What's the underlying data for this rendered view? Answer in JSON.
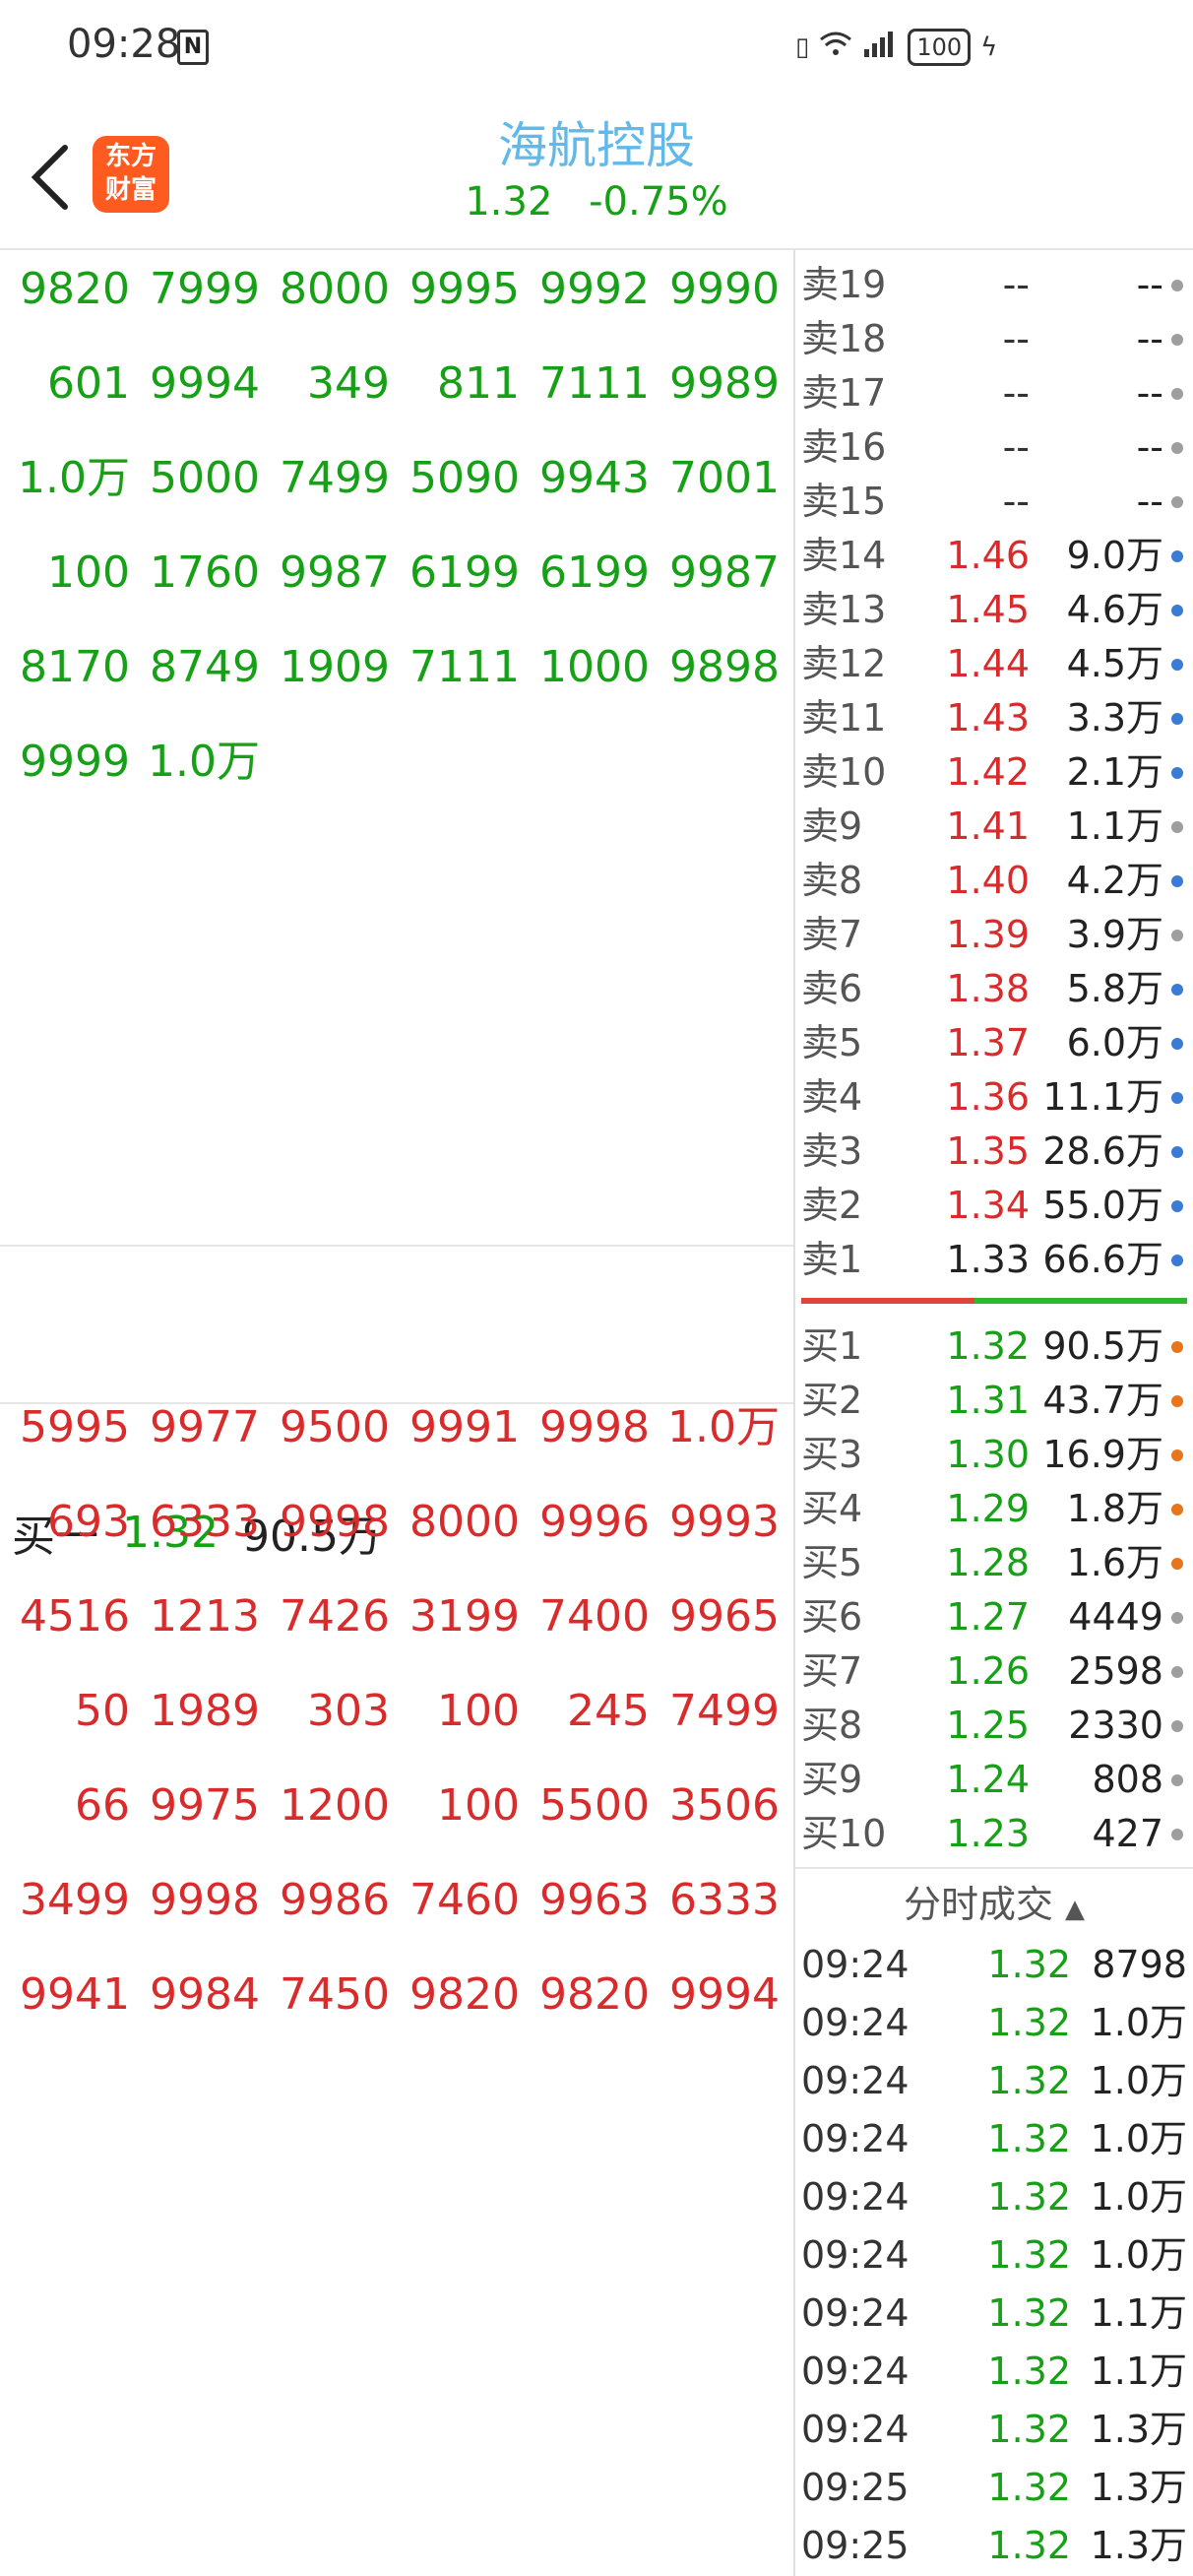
{
  "status": {
    "time": "09:28",
    "battery": "100"
  },
  "header": {
    "title": "海航控股",
    "price": "1.32",
    "change": "-0.75%",
    "logo_text_1": "东方",
    "logo_text_2": "财富"
  },
  "sell_queue": [
    [
      "9820",
      "7999",
      "8000",
      "9995",
      "9992",
      "9990"
    ],
    [
      "601",
      "9994",
      "349",
      "811",
      "7111",
      "9989"
    ],
    [
      "1.0万",
      "5000",
      "7499",
      "5090",
      "9943",
      "7001"
    ],
    [
      "100",
      "1760",
      "9987",
      "6199",
      "6199",
      "9987"
    ],
    [
      "8170",
      "8749",
      "1909",
      "7111",
      "1000",
      "9898"
    ],
    [
      "9999",
      "1.0万",
      "",
      "",
      "",
      ""
    ]
  ],
  "buy_one": {
    "label": "买一",
    "price": "1.32",
    "volume": "90.5万"
  },
  "buy_queue": [
    [
      "5995",
      "9977",
      "9500",
      "9991",
      "9998",
      "1.0万"
    ],
    [
      "693",
      "6333",
      "9998",
      "8000",
      "9996",
      "9993"
    ],
    [
      "4516",
      "1213",
      "7426",
      "3199",
      "7400",
      "9965"
    ],
    [
      "50",
      "1989",
      "303",
      "100",
      "245",
      "7499"
    ],
    [
      "66",
      "9975",
      "1200",
      "100",
      "5500",
      "3506"
    ],
    [
      "3499",
      "9998",
      "9986",
      "7460",
      "9963",
      "6333"
    ],
    [
      "9941",
      "9984",
      "7450",
      "9820",
      "9820",
      "9994"
    ]
  ],
  "order_book": {
    "asks": [
      {
        "label": "卖19",
        "price": "--",
        "volume": "--",
        "dot": "#9e9e9e",
        "pc": "#333333"
      },
      {
        "label": "卖18",
        "price": "--",
        "volume": "--",
        "dot": "#9e9e9e",
        "pc": "#333333"
      },
      {
        "label": "卖17",
        "price": "--",
        "volume": "--",
        "dot": "#9e9e9e",
        "pc": "#333333"
      },
      {
        "label": "卖16",
        "price": "--",
        "volume": "--",
        "dot": "#9e9e9e",
        "pc": "#333333"
      },
      {
        "label": "卖15",
        "price": "--",
        "volume": "--",
        "dot": "#9e9e9e",
        "pc": "#333333"
      },
      {
        "label": "卖14",
        "price": "1.46",
        "volume": "9.0万",
        "dot": "#3a7bd5",
        "pc": "#d92b2b"
      },
      {
        "label": "卖13",
        "price": "1.45",
        "volume": "4.6万",
        "dot": "#3a7bd5",
        "pc": "#d92b2b"
      },
      {
        "label": "卖12",
        "price": "1.44",
        "volume": "4.5万",
        "dot": "#3a7bd5",
        "pc": "#d92b2b"
      },
      {
        "label": "卖11",
        "price": "1.43",
        "volume": "3.3万",
        "dot": "#3a7bd5",
        "pc": "#d92b2b"
      },
      {
        "label": "卖10",
        "price": "1.42",
        "volume": "2.1万",
        "dot": "#3a7bd5",
        "pc": "#d92b2b"
      },
      {
        "label": "卖9",
        "price": "1.41",
        "volume": "1.1万",
        "dot": "#9e9e9e",
        "pc": "#d92b2b"
      },
      {
        "label": "卖8",
        "price": "1.40",
        "volume": "4.2万",
        "dot": "#3a7bd5",
        "pc": "#d92b2b"
      },
      {
        "label": "卖7",
        "price": "1.39",
        "volume": "3.9万",
        "dot": "#9e9e9e",
        "pc": "#d92b2b"
      },
      {
        "label": "卖6",
        "price": "1.38",
        "volume": "5.8万",
        "dot": "#3a7bd5",
        "pc": "#d92b2b"
      },
      {
        "label": "卖5",
        "price": "1.37",
        "volume": "6.0万",
        "dot": "#3a7bd5",
        "pc": "#d92b2b"
      },
      {
        "label": "卖4",
        "price": "1.36",
        "volume": "11.1万",
        "dot": "#3a7bd5",
        "pc": "#d92b2b"
      },
      {
        "label": "卖3",
        "price": "1.35",
        "volume": "28.6万",
        "dot": "#3a7bd5",
        "pc": "#d92b2b"
      },
      {
        "label": "卖2",
        "price": "1.34",
        "volume": "55.0万",
        "dot": "#3a7bd5",
        "pc": "#d92b2b"
      },
      {
        "label": "卖1",
        "price": "1.33",
        "volume": "66.6万",
        "dot": "#3a7bd5",
        "pc": "#222222"
      }
    ],
    "bids": [
      {
        "label": "买1",
        "price": "1.32",
        "volume": "90.5万",
        "dot": "#e8741c",
        "pc": "#16a016"
      },
      {
        "label": "买2",
        "price": "1.31",
        "volume": "43.7万",
        "dot": "#e8741c",
        "pc": "#16a016"
      },
      {
        "label": "买3",
        "price": "1.30",
        "volume": "16.9万",
        "dot": "#e8741c",
        "pc": "#16a016"
      },
      {
        "label": "买4",
        "price": "1.29",
        "volume": "1.8万",
        "dot": "#e8741c",
        "pc": "#16a016"
      },
      {
        "label": "买5",
        "price": "1.28",
        "volume": "1.6万",
        "dot": "#e8741c",
        "pc": "#16a016"
      },
      {
        "label": "买6",
        "price": "1.27",
        "volume": "4449",
        "dot": "#9e9e9e",
        "pc": "#16a016"
      },
      {
        "label": "买7",
        "price": "1.26",
        "volume": "2598",
        "dot": "#9e9e9e",
        "pc": "#16a016"
      },
      {
        "label": "买8",
        "price": "1.25",
        "volume": "2330",
        "dot": "#9e9e9e",
        "pc": "#16a016"
      },
      {
        "label": "买9",
        "price": "1.24",
        "volume": "808",
        "dot": "#9e9e9e",
        "pc": "#16a016"
      },
      {
        "label": "买10",
        "price": "1.23",
        "volume": "427",
        "dot": "#9e9e9e",
        "pc": "#16a016"
      }
    ]
  },
  "trades": {
    "title": "分时成交",
    "rows": [
      {
        "time": "09:24",
        "price": "1.32",
        "volume": "8798"
      },
      {
        "time": "09:24",
        "price": "1.32",
        "volume": "1.0万"
      },
      {
        "time": "09:24",
        "price": "1.32",
        "volume": "1.0万"
      },
      {
        "time": "09:24",
        "price": "1.32",
        "volume": "1.0万"
      },
      {
        "time": "09:24",
        "price": "1.32",
        "volume": "1.0万"
      },
      {
        "time": "09:24",
        "price": "1.32",
        "volume": "1.0万"
      },
      {
        "time": "09:24",
        "price": "1.32",
        "volume": "1.1万"
      },
      {
        "time": "09:24",
        "price": "1.32",
        "volume": "1.1万"
      },
      {
        "time": "09:24",
        "price": "1.32",
        "volume": "1.3万"
      },
      {
        "time": "09:25",
        "price": "1.32",
        "volume": "1.3万"
      },
      {
        "time": "09:25",
        "price": "1.32",
        "volume": "1.3万"
      }
    ]
  },
  "colors": {
    "green": "#16a016",
    "red": "#d92b2b",
    "title_blue": "#61b9ea",
    "logo_orange": "#ff5a1f"
  }
}
